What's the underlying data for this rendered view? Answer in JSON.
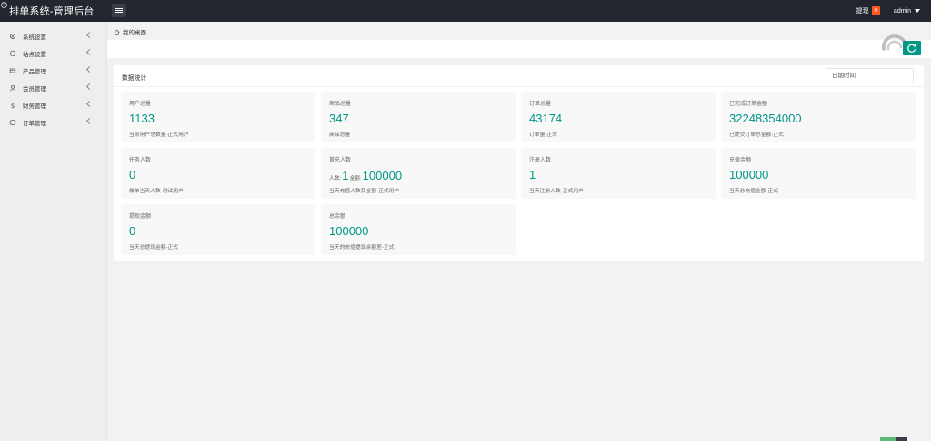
{
  "header": {
    "title": "排单系统-管理后台",
    "withdraw_label": "提现",
    "withdraw_count": "0",
    "user_name": "admin"
  },
  "sidebar": {
    "items": [
      {
        "label": "系统设置",
        "icon": "gear-icon"
      },
      {
        "label": "站点设置",
        "icon": "sync-icon"
      },
      {
        "label": "产品管理",
        "icon": "box-icon"
      },
      {
        "label": "会员管理",
        "icon": "user-icon"
      },
      {
        "label": "财务管理",
        "icon": "dollar-icon"
      },
      {
        "label": "订单管理",
        "icon": "order-icon"
      }
    ]
  },
  "breadcrumb": {
    "label": "我的桌面"
  },
  "panel": {
    "title": "数据统计",
    "date_placeholder": "日期时间"
  },
  "stats": [
    {
      "label": "用户总量",
      "value": "1133",
      "desc": "当前用户总数量-正式用户"
    },
    {
      "label": "商品总量",
      "value": "347",
      "desc": "商品总量"
    },
    {
      "label": "订单总量",
      "value": "43174",
      "desc": "订单量-正式"
    },
    {
      "label": "已完成订单金额",
      "value": "32248354000",
      "desc": "已提交订单总金额-正式"
    },
    {
      "label": "任务人数",
      "value": "0",
      "desc": "做单当天人数-测试用户"
    },
    {
      "label": "首充人数",
      "count_prefix": "人数:",
      "count": "1",
      "amount_prefix": "金额:",
      "amount": "100000",
      "desc": "当天充值人数及金额-正式用户"
    },
    {
      "label": "注册人数",
      "value": "1",
      "desc": "当天注册人数-正式用户"
    },
    {
      "label": "充值金额",
      "value": "100000",
      "desc": "当天总充值金额-正式"
    },
    {
      "label": "提现金额",
      "value": "0",
      "desc": "当天总提现金额-正式"
    },
    {
      "label": "总余额",
      "value": "100000",
      "desc": "当天的充值提现余额差-正式"
    }
  ],
  "colors": {
    "accent": "#009688",
    "topbar": "#23262e",
    "badge": "#ff5722"
  }
}
